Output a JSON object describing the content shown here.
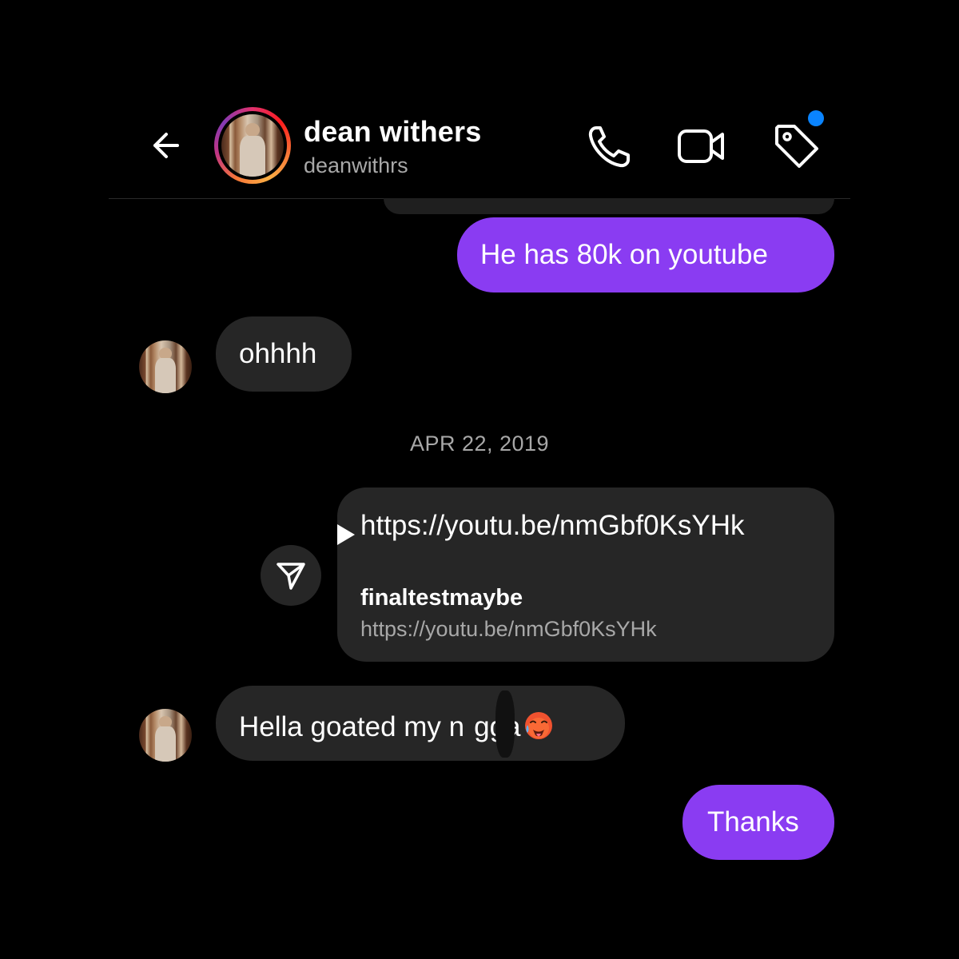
{
  "header": {
    "name": "dean withers",
    "username": "deanwithrs",
    "icons": [
      "back-arrow-icon",
      "phone-icon",
      "video-icon",
      "tag-icon"
    ],
    "notification_dot_color": "#0a84ff"
  },
  "messages": [
    {
      "direction": "outgoing",
      "text": "He has 80k on youtube"
    },
    {
      "direction": "incoming",
      "text": "ohhhh"
    }
  ],
  "date_separator": "APR 22, 2019",
  "link_share": {
    "url_text": "https://youtu.be/nmGbf0KsYHk",
    "title": "finaltestmaybe",
    "subtitle": "https://youtu.be/nmGbf0KsYHk"
  },
  "later_messages": [
    {
      "direction": "incoming",
      "text": "Hella goated my n",
      "text_after_mark": "gga",
      "emoji": "hot-face-emoji"
    },
    {
      "direction": "outgoing",
      "text": "Thanks"
    }
  ],
  "colors": {
    "outgoing_bubble": "#8a3cf2",
    "outgoing_bubble_latest": "#7b55f5",
    "incoming_bubble": "#262626",
    "secondary_text": "#a8a8a8"
  }
}
